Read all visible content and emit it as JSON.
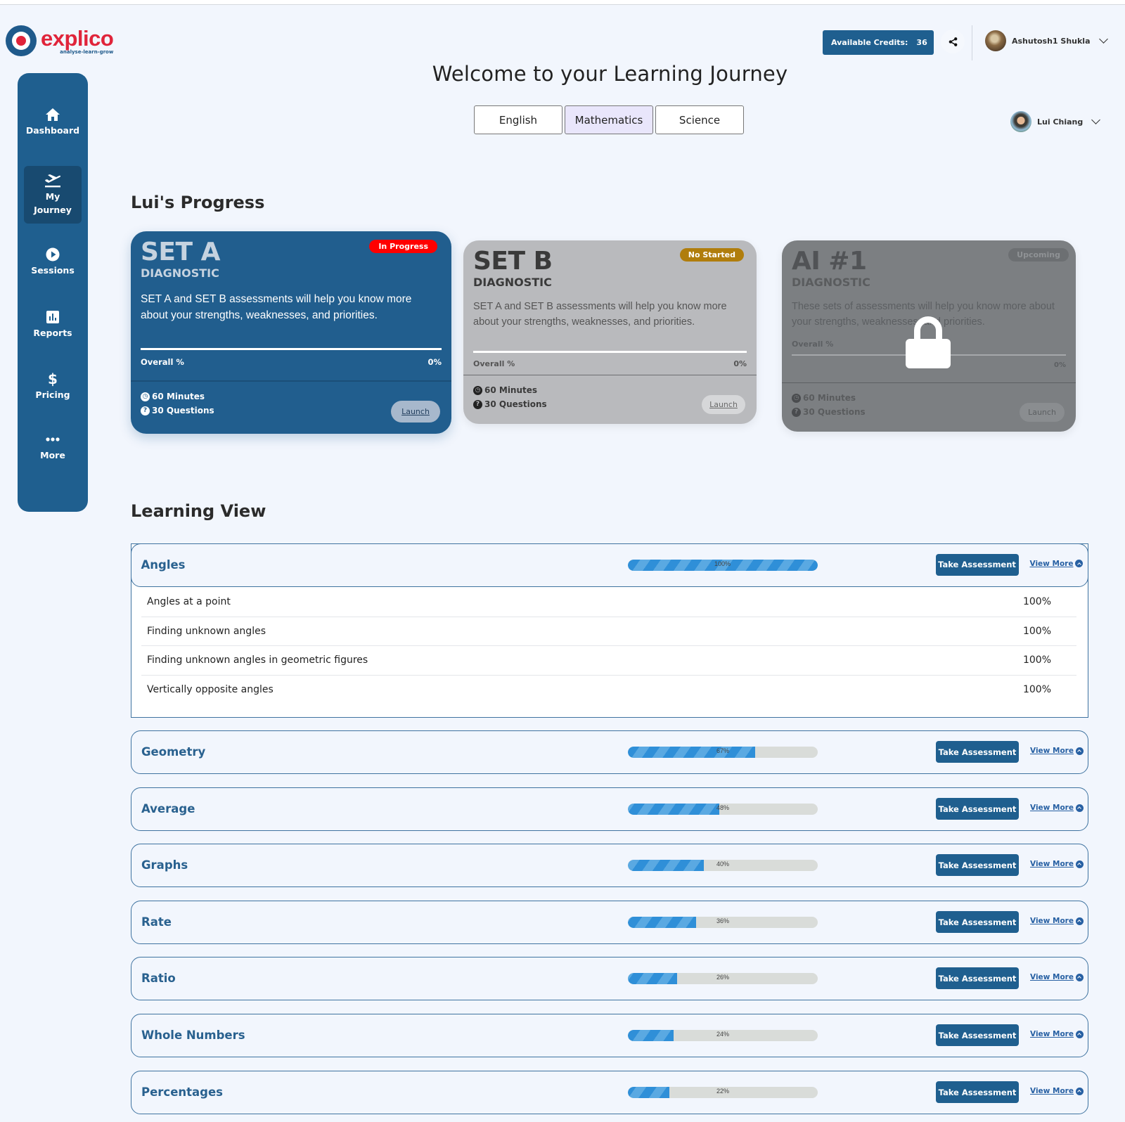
{
  "brand": {
    "name": "explico",
    "tagline": "analyse-learn-grow"
  },
  "header": {
    "credits_label": "Available Credits:",
    "credits_value": "36",
    "parent_user": "Ashutosh1 Shukla",
    "child_user": "Lui Chiang"
  },
  "page_title": "Welcome to your Learning Journey",
  "subject_tabs": [
    {
      "label": "English",
      "active": false
    },
    {
      "label": "Mathematics",
      "active": true
    },
    {
      "label": "Science",
      "active": false
    }
  ],
  "sidebar": {
    "items": [
      {
        "label": "Dashboard",
        "icon": "home-icon"
      },
      {
        "label": "My",
        "label2": "Journey",
        "icon": "plane-departure-icon",
        "active": true
      },
      {
        "label": "Sessions",
        "icon": "play-circle-icon"
      },
      {
        "label": "Reports",
        "icon": "bar-chart-icon"
      },
      {
        "label": "Pricing",
        "icon": "dollar-icon"
      },
      {
        "label": "More",
        "icon": "more-dots-icon"
      }
    ]
  },
  "progress": {
    "title": "Lui's Progress",
    "cards": [
      {
        "title": "SET A",
        "subtitle": "DIAGNOSTIC",
        "status": "In Progress",
        "status_color": "#ff0000",
        "description": "SET A and SET B assessments will help you know more about your strengths, weaknesses, and priorities.",
        "overall_label": "Overall %",
        "overall_value": "0%",
        "duration": "60 Minutes",
        "questions": "30 Questions",
        "action": "Launch"
      },
      {
        "title": "SET B",
        "subtitle": "DIAGNOSTIC",
        "status": "No Started",
        "status_color": "#b07d0c",
        "description": "SET A and SET B assessments will help you know more about your strengths, weaknesses, and priorities.",
        "overall_label": "Overall %",
        "overall_value": "0%",
        "duration": "60 Minutes",
        "questions": "30 Questions",
        "action": "Launch"
      },
      {
        "title": "AI #1",
        "subtitle": "DIAGNOSTIC",
        "status": "Upcoming",
        "status_color": "#6c6f72",
        "locked": true,
        "description": "These sets of assessments will help you know more about your strengths, weaknesses, and priorities.",
        "overall_label": "Overall %",
        "overall_value": "0%",
        "duration": "60 Minutes",
        "questions": "30 Questions",
        "action": "Launch"
      }
    ]
  },
  "learning_view": {
    "title": "Learning View",
    "take_label": "Take Assessment",
    "view_more_label": "View More",
    "topics": [
      {
        "name": "Angles",
        "percent": 100,
        "percent_label": "100%",
        "expanded": true,
        "subtopics": [
          {
            "name": "Angles at a point",
            "percent": "100%"
          },
          {
            "name": "Finding unknown angles",
            "percent": "100%"
          },
          {
            "name": "Finding unknown angles in geometric figures",
            "percent": "100%"
          },
          {
            "name": "Vertically opposite angles",
            "percent": "100%"
          }
        ]
      },
      {
        "name": "Geometry",
        "percent": 67,
        "percent_label": "67%"
      },
      {
        "name": "Average",
        "percent": 48,
        "percent_label": "48%"
      },
      {
        "name": "Graphs",
        "percent": 40,
        "percent_label": "40%"
      },
      {
        "name": "Rate",
        "percent": 36,
        "percent_label": "36%"
      },
      {
        "name": "Ratio",
        "percent": 26,
        "percent_label": "26%"
      },
      {
        "name": "Whole Numbers",
        "percent": 24,
        "percent_label": "24%"
      },
      {
        "name": "Percentages",
        "percent": 22,
        "percent_label": "22%"
      }
    ]
  }
}
